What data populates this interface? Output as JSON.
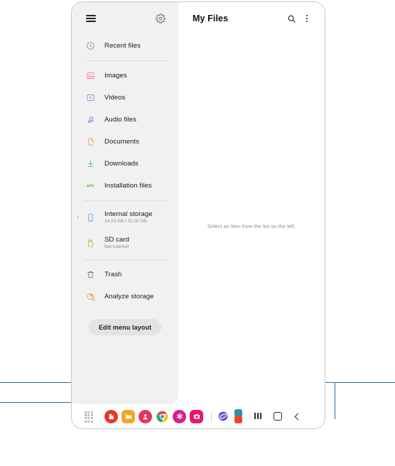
{
  "app": {
    "title": "My Files",
    "empty_state": "Select an item from the list on the left.",
    "menu_icon": "hamburger-icon",
    "settings_icon": "gear-icon",
    "search_icon": "search-icon",
    "more_icon": "more-options-icon"
  },
  "sidebar": {
    "edit_menu_label": "Edit menu layout",
    "groups": [
      {
        "items": [
          {
            "label": "Recent files",
            "sub": "",
            "icon": "clock-icon",
            "color": "#8e8e8e",
            "expandable": false
          }
        ]
      },
      {
        "items": [
          {
            "label": "Images",
            "sub": "",
            "icon": "image-icon",
            "color": "#ef7f8e",
            "expandable": false
          },
          {
            "label": "Videos",
            "sub": "",
            "icon": "video-icon",
            "color": "#b07ad6",
            "expandable": false
          },
          {
            "label": "Audio files",
            "sub": "",
            "icon": "audio-icon",
            "color": "#8a7fd6",
            "expandable": false
          },
          {
            "label": "Documents",
            "sub": "",
            "icon": "document-icon",
            "color": "#e8a94f",
            "expandable": false
          },
          {
            "label": "Downloads",
            "sub": "",
            "icon": "download-icon",
            "color": "#4fb99a",
            "expandable": false
          },
          {
            "label": "Installation files",
            "sub": "",
            "icon": "apk-icon",
            "color": "#5bbd3a",
            "expandable": false
          }
        ]
      },
      {
        "items": [
          {
            "label": "Internal storage",
            "sub": "14.24 GB / 32.00 GB",
            "icon": "phone-storage-icon",
            "color": "#5aa9e6",
            "expandable": true
          },
          {
            "label": "SD card",
            "sub": "Not inserted",
            "icon": "sd-card-icon",
            "color": "#b6c44a",
            "expandable": false
          }
        ]
      },
      {
        "items": [
          {
            "label": "Trash",
            "sub": "",
            "icon": "trash-icon",
            "color": "#7a7a7a",
            "expandable": false
          },
          {
            "label": "Analyze storage",
            "sub": "",
            "icon": "analyze-storage-icon",
            "color": "#e8a13a",
            "expandable": false
          }
        ]
      }
    ]
  },
  "taskbar": {
    "apps_grid_label": "apps-grid-button",
    "shortcuts": [
      {
        "name": "samsung-notes",
        "color": "#e8352b",
        "shape": "circle",
        "glyph": "note"
      },
      {
        "name": "my-files",
        "color": "#f5a623",
        "shape": "square",
        "glyph": "folder"
      },
      {
        "name": "contacts",
        "color": "#e8335c",
        "shape": "circle",
        "glyph": "person"
      },
      {
        "name": "chrome",
        "color": "#ffffff",
        "shape": "circle",
        "glyph": "chrome"
      },
      {
        "name": "gallery",
        "color": "#d6208c",
        "shape": "circle",
        "glyph": "flower"
      },
      {
        "name": "camera",
        "color": "#e8186b",
        "shape": "square",
        "glyph": "camera"
      }
    ],
    "running_app": {
      "name": "samsung-internet",
      "color": "#6b4fc4",
      "glyph": "internet"
    },
    "recents": [
      {
        "name": "recent-app-1",
        "color": "#2196a8"
      },
      {
        "name": "recent-app-2",
        "color": "#e8452a"
      }
    ],
    "nav": [
      {
        "name": "recents-button",
        "icon": "recents-icon"
      },
      {
        "name": "home-button",
        "icon": "home-icon"
      },
      {
        "name": "back-button",
        "icon": "back-icon"
      }
    ]
  },
  "annotation": {
    "line_color": "#2e6e96"
  }
}
